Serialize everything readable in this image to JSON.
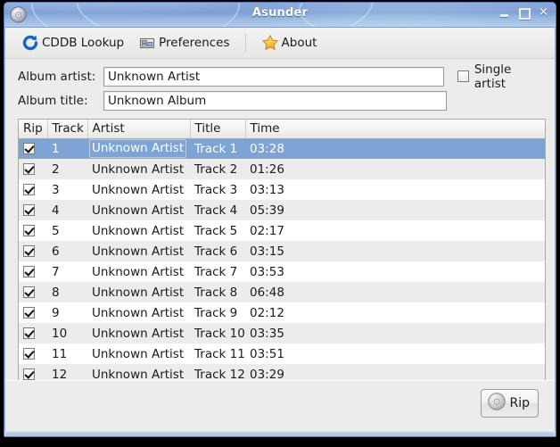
{
  "window": {
    "title": "Asunder",
    "icon": "cd-disc-icon",
    "controls": {
      "minimize": "minimize-button",
      "maximize": "maximize-button",
      "close": "close-button",
      "close_glyph": "✕"
    },
    "colors": {
      "titlebar_start": "#8aa7d8",
      "titlebar_end": "#b6cbe9",
      "client_bg": "#ececea",
      "selection": "#7da4d4",
      "border": "#5a79b5"
    }
  },
  "toolbar": {
    "items": [
      {
        "label": "CDDB Lookup",
        "icon": "refresh-icon"
      },
      {
        "label": "Preferences",
        "icon": "preferences-panel-icon"
      },
      {
        "label": "About",
        "icon": "star-icon"
      }
    ]
  },
  "form": {
    "album_artist": {
      "label": "Album artist:",
      "value": "Unknown Artist",
      "placeholder": ""
    },
    "album_title": {
      "label": "Album title:",
      "value": "Unknown Album",
      "placeholder": ""
    },
    "single_artist": {
      "label": "Single artist",
      "checked": false
    }
  },
  "table": {
    "headers": [
      "Rip",
      "Track",
      "Artist",
      "Title",
      "Time"
    ],
    "selected_row_index": 0,
    "rows": [
      {
        "rip": true,
        "track": "1",
        "artist": "Unknown Artist",
        "title": "Track 1",
        "time": "03:28"
      },
      {
        "rip": true,
        "track": "2",
        "artist": "Unknown Artist",
        "title": "Track 2",
        "time": "01:26"
      },
      {
        "rip": true,
        "track": "3",
        "artist": "Unknown Artist",
        "title": "Track 3",
        "time": "03:13"
      },
      {
        "rip": true,
        "track": "4",
        "artist": "Unknown Artist",
        "title": "Track 4",
        "time": "05:39"
      },
      {
        "rip": true,
        "track": "5",
        "artist": "Unknown Artist",
        "title": "Track 5",
        "time": "02:17"
      },
      {
        "rip": true,
        "track": "6",
        "artist": "Unknown Artist",
        "title": "Track 6",
        "time": "03:15"
      },
      {
        "rip": true,
        "track": "7",
        "artist": "Unknown Artist",
        "title": "Track 7",
        "time": "03:53"
      },
      {
        "rip": true,
        "track": "8",
        "artist": "Unknown Artist",
        "title": "Track 8",
        "time": "06:48"
      },
      {
        "rip": true,
        "track": "9",
        "artist": "Unknown Artist",
        "title": "Track 9",
        "time": "02:12"
      },
      {
        "rip": true,
        "track": "10",
        "artist": "Unknown Artist",
        "title": "Track 10",
        "time": "03:35"
      },
      {
        "rip": true,
        "track": "11",
        "artist": "Unknown Artist",
        "title": "Track 11",
        "time": "03:51"
      },
      {
        "rip": true,
        "track": "12",
        "artist": "Unknown Artist",
        "title": "Track 12",
        "time": "03:29"
      }
    ]
  },
  "footer": {
    "rip_button": {
      "label": "Rip",
      "icon": "cd-disc-icon"
    }
  }
}
